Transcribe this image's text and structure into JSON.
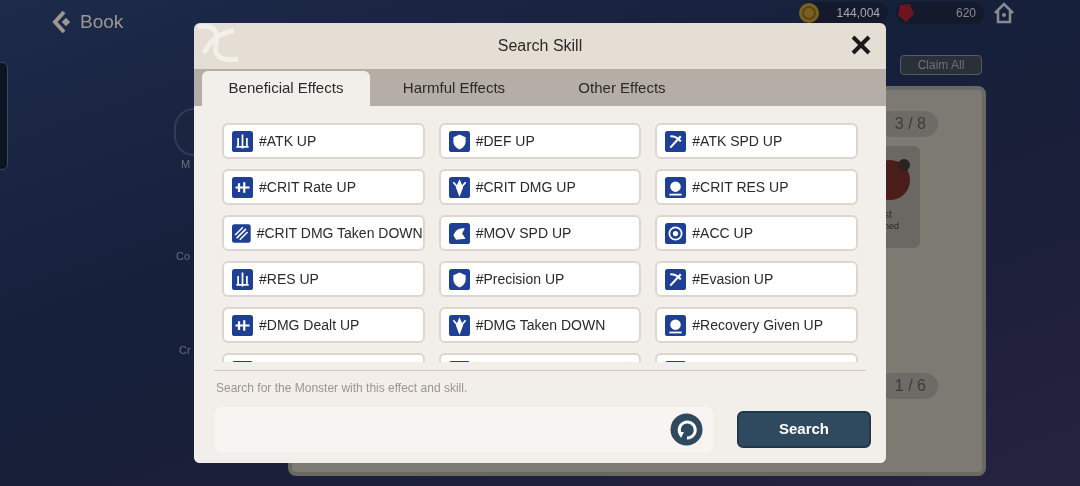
{
  "header": {
    "back_label": "Book",
    "gold": "144,004",
    "gems": "620"
  },
  "background": {
    "claim_button": "Claim All",
    "counters": [
      "3 / 8",
      "1 / 6"
    ],
    "side_labels": [
      "M",
      "Co",
      "Cr"
    ],
    "card_texts": [
      "st",
      "ned"
    ]
  },
  "dialog": {
    "title": "Search Skill",
    "tabs": [
      {
        "label": "Beneficial Effects",
        "selected": true
      },
      {
        "label": "Harmful Effects",
        "selected": false
      },
      {
        "label": "Other Effects",
        "selected": false
      }
    ],
    "effects": [
      {
        "label": "#ATK UP"
      },
      {
        "label": "#DEF UP"
      },
      {
        "label": "#ATK SPD UP"
      },
      {
        "label": "#CRIT Rate UP"
      },
      {
        "label": "#CRIT DMG UP"
      },
      {
        "label": "#CRIT RES UP"
      },
      {
        "label": "#CRIT DMG Taken DOWN"
      },
      {
        "label": "#MOV SPD UP"
      },
      {
        "label": "#ACC UP"
      },
      {
        "label": "#RES UP"
      },
      {
        "label": "#Precision UP"
      },
      {
        "label": "#Evasion UP"
      },
      {
        "label": "#DMG Dealt UP"
      },
      {
        "label": "#DMG Taken DOWN"
      },
      {
        "label": "#Recovery Given UP"
      }
    ],
    "hint": "Search for the Monster with this effect and skill.",
    "search_button": "Search"
  }
}
